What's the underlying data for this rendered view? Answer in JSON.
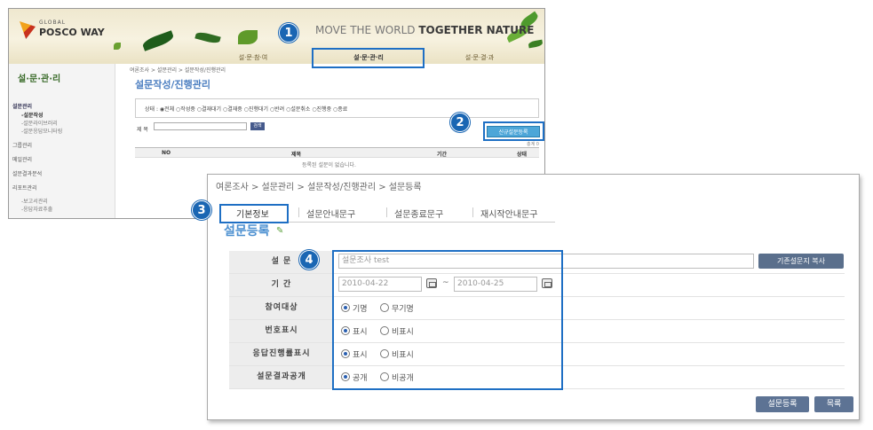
{
  "back": {
    "logo_small": "GLOBAL",
    "logo_big": "POSCO WAY",
    "slogan_pre": "MOVE THE WORLD",
    "slogan_bold": "TOGETHER NATURE",
    "menu_tabs": [
      "설·문·참·여",
      "설·문·관·리",
      "설·문·결·과"
    ],
    "left_menu": {
      "title": "설·문·관·리",
      "items": [
        "설문관리",
        "그룹관리",
        "메일관리",
        "설문결과분석",
        "리포트관리"
      ],
      "sub_items_a": [
        "-설문작성",
        "-설문라이브러리",
        "-설문응답모니터링"
      ],
      "sub_items_b": [
        "-보고서관리",
        "-응답자료추출"
      ]
    },
    "breadcrumb": "여론조사 > 설문관리 > 설문작성/진행관리",
    "title": "설문작성/진행관리",
    "status_line": "상태 :  ◉전체  ○작성중  ○결재대기  ○결재중  ○진행대기  ○반려  ○설문취소  ○진행중  ○종료",
    "title_label": "제 목",
    "search_btn": "검색",
    "new_btn": "신규설문등록",
    "count": "총계 0",
    "table_headers": [
      "NO",
      "제목",
      "기간",
      "상태"
    ],
    "empty_msg": "등록된 설문이 없습니다."
  },
  "badges": [
    "1",
    "2",
    "3",
    "4"
  ],
  "front": {
    "breadcrumb": "여론조사 > 설문관리 > 설문작성/진행관리 > 설문등록",
    "tabs": [
      "기본정보",
      "설문안내문구",
      "설문종료문구",
      "재시작안내문구"
    ],
    "title": "설문등록",
    "form": {
      "survey_label": "설 문",
      "survey_value": "설문조사 test",
      "copy_btn": "기존설문지 복사",
      "period_label": "기 간",
      "start_date": "2010-04-22",
      "end_date": "2010-04-25",
      "period_dash": "~",
      "target_label": "참여대상",
      "target_opts": [
        "기명",
        "무기명"
      ],
      "number_label": "번호표시",
      "number_opts": [
        "표시",
        "비표시"
      ],
      "progress_label": "응답진행률표시",
      "progress_opts": [
        "표시",
        "비표시"
      ],
      "result_label": "설문결과공개",
      "result_opts": [
        "공개",
        "비공개"
      ]
    },
    "btn_register": "설문등록",
    "btn_list": "목록"
  }
}
